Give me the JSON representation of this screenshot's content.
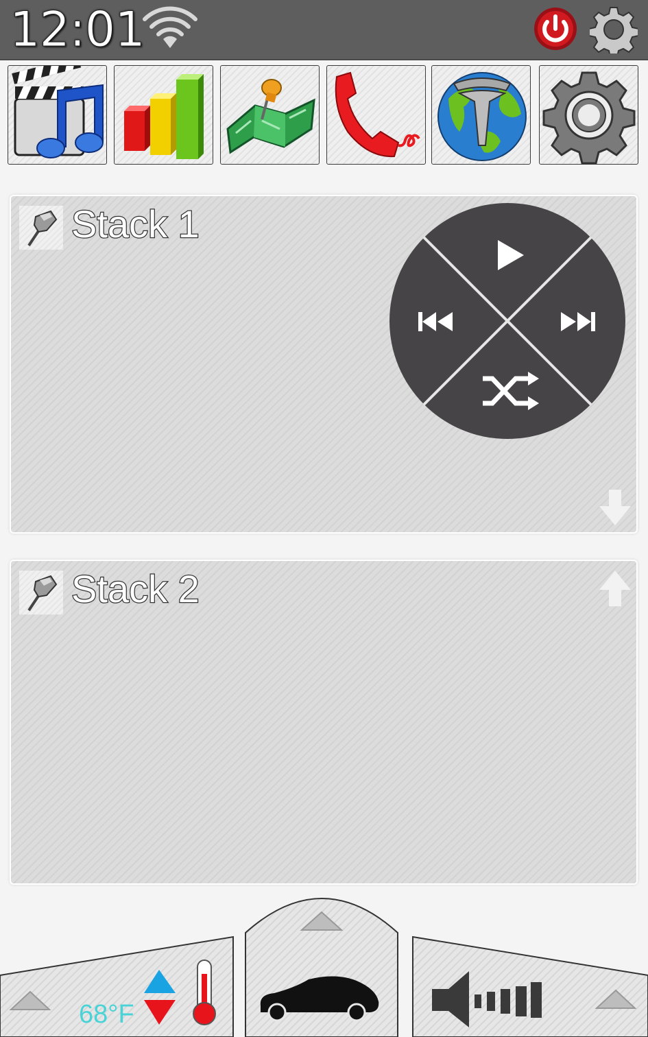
{
  "status_bar": {
    "time": "12:01",
    "icons": [
      "wifi-icon",
      "power-icon",
      "settings-gear-icon"
    ],
    "power_color": "#c0141b"
  },
  "app_tray": {
    "apps": [
      {
        "name": "media-app",
        "icon": "clapperboard-music-icon"
      },
      {
        "name": "stats-app",
        "icon": "bar-chart-icon"
      },
      {
        "name": "maps-app",
        "icon": "map-pin-icon"
      },
      {
        "name": "phone-app",
        "icon": "phone-handset-icon"
      },
      {
        "name": "browser-app",
        "icon": "globe-tesla-icon"
      },
      {
        "name": "settings-app",
        "icon": "gear-icon"
      }
    ]
  },
  "stacks": [
    {
      "title": "Stack 1",
      "pin_icon": "pushpin-icon",
      "arrow_icon": "arrow-down-icon"
    },
    {
      "title": "Stack 2",
      "pin_icon": "pushpin-icon",
      "arrow_icon": "arrow-up-icon"
    }
  ],
  "media_controls": {
    "buttons": [
      "play-icon",
      "previous-icon",
      "next-icon",
      "shuffle-icon"
    ],
    "color": "#464446"
  },
  "bottom_bar": {
    "climate": {
      "temperature": "68°F",
      "up_color": "#1aa3e3",
      "down_color": "#e8141c"
    },
    "vehicle_icon": "car-icon",
    "volume_icon": "speaker-volume-icon"
  }
}
